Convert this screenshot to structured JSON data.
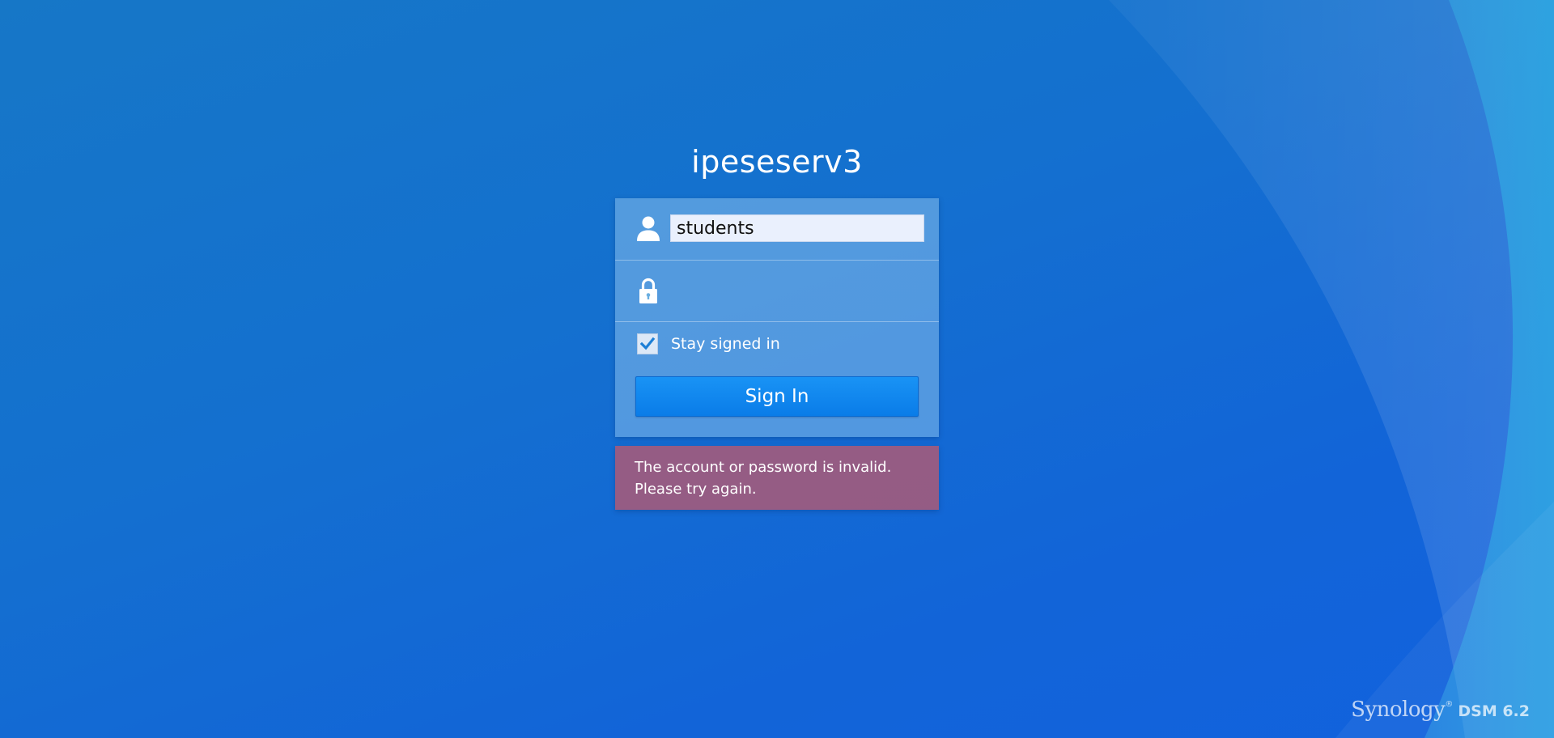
{
  "login": {
    "hostname": "ipeseserv3",
    "username_value": "students",
    "password_value": "",
    "stay_signed_in_label": "Stay signed in",
    "stay_signed_in_checked": true,
    "sign_in_label": "Sign In"
  },
  "error": {
    "line1": "The account or password is invalid.",
    "line2": "Please try again."
  },
  "branding": {
    "brand": "Synology",
    "registered": "®",
    "product": "DSM 6.2"
  },
  "icons": {
    "user": "user-icon",
    "lock": "lock-icon",
    "check": "checkmark-icon"
  },
  "colors": {
    "background": "#1470cf",
    "panel": "#87beeb",
    "button": "#0a7ce8",
    "error": "#9c5c80"
  }
}
